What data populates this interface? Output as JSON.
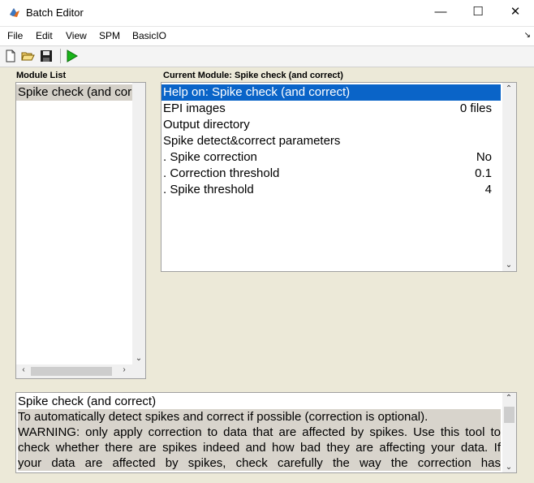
{
  "window": {
    "title": "Batch Editor",
    "minimize_glyph": "—",
    "maximize_glyph": "☐",
    "close_glyph": "✕"
  },
  "menu": {
    "items": [
      "File",
      "Edit",
      "View",
      "SPM",
      "BasicIO"
    ],
    "overflow_glyph": "↘"
  },
  "toolbar": {
    "icons": [
      "new-file-icon",
      "open-folder-icon",
      "save-icon",
      "run-icon"
    ]
  },
  "module_list": {
    "label": "Module List",
    "items": [
      "Spike check (and correct)"
    ]
  },
  "current_module": {
    "label": "Current Module: Spike check (and correct)",
    "rows": [
      {
        "name": "Help on: Spike check (and correct)",
        "value": "",
        "selected": true
      },
      {
        "name": "EPI images",
        "value": "0 files"
      },
      {
        "name": "Output directory",
        "value": ""
      },
      {
        "name": "Spike detect&correct parameters",
        "value": ""
      },
      {
        "name": ". Spike correction",
        "value": "No"
      },
      {
        "name": ". Correction threshold",
        "value": "0.1"
      },
      {
        "name": ". Spike threshold",
        "value": "4"
      }
    ]
  },
  "help": {
    "lines": [
      "Spike check (and correct)",
      "To automatically detect spikes and correct if possible (correction is optional).",
      "WARNING: only apply correction to data that are affected by spikes. Use this tool to",
      "check whether there are spikes indeed and how bad they are affecting your data. If",
      "your data are affected by spikes, check carefully the way the correction has"
    ]
  },
  "colors": {
    "window_bg": "#ece9d8",
    "selection": "#0a64c8",
    "module_highlight": "#d4d0c8"
  }
}
